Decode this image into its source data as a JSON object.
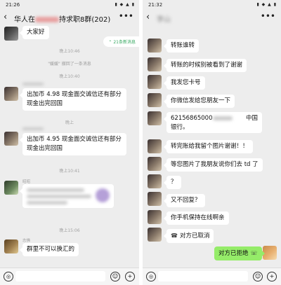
{
  "left": {
    "status_time": "21:26",
    "status_icons": "▮ ◆ ▲ ▮",
    "title_prefix": "华人在",
    "title_suffix": "持求职8群(202)",
    "more": "•••",
    "messages": {
      "greeting": "大家好",
      "new_badge": "21条新消息",
      "ts1": "晚上10:46",
      "system": "\"媛媛\" 撤回了一条消息",
      "ts2": "晚上10:40",
      "msg1": "出加币 4.98 现金面交诚信还有部分现金出完回国",
      "ts3": "晚上",
      "msg2": "出加币 4.95 现金面交诚信还有部分现金出完回国",
      "ts4": "晚上10:41",
      "sender3": "昭昭",
      "ts5": "晚上15:06",
      "sender4": "志佛",
      "msg4": "群里不可以换汇的"
    }
  },
  "right": {
    "status_time": "21:32",
    "status_icons": "▮ ◆ ▲ ▮",
    "title": "李山",
    "more": "•••",
    "messages": {
      "m1": "转账谁转",
      "m2": "转账的时候别被看到了谢谢",
      "m3": "我发您卡号",
      "m4": "你微信发给您朋友一下",
      "m5a": "62156865000",
      "m5b": "中国",
      "m5c": "银行。",
      "m6": "转完账给我留个图片谢谢！！",
      "m7": "等您图片了我朋友说你们去 td 了",
      "m8": "？",
      "m9": "又不回复？",
      "m10": "你手机保持在线啊亲",
      "m11": "对方已取消",
      "m12": "对方已拒绝"
    }
  },
  "input": {
    "voice": "◎",
    "emoji": "☺",
    "plus": "+"
  },
  "icons": {
    "back": "chevron-left-icon",
    "more": "more-icon",
    "call": "phone-icon"
  }
}
